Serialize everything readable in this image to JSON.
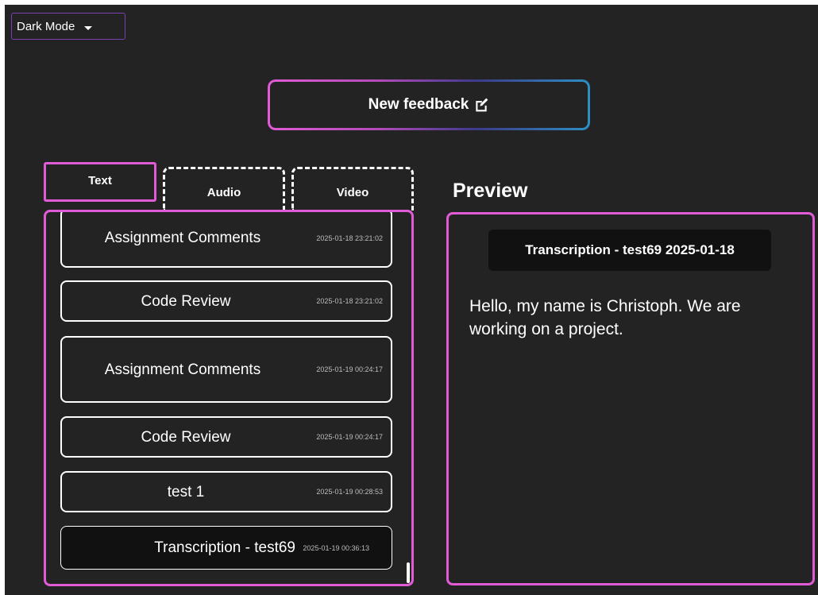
{
  "theme": {
    "selected": "Dark Mode"
  },
  "new_feedback": {
    "label": "New feedback"
  },
  "tabs": [
    {
      "label": "Text",
      "active": true
    },
    {
      "label": "Audio",
      "active": false
    },
    {
      "label": "Video",
      "active": false
    }
  ],
  "feedback_list": [
    {
      "title": "Assignment Comments",
      "date": "2025-01-18 23:21:02"
    },
    {
      "title": "Code Review",
      "date": "2025-01-18 23:21:02"
    },
    {
      "title": "Assignment Comments",
      "date": "2025-01-19 00:24:17"
    },
    {
      "title": "Code Review",
      "date": "2025-01-19 00:24:17"
    },
    {
      "title": "test 1",
      "date": "2025-01-19 00:28:53"
    },
    {
      "title": "Transcription - test69",
      "date": "2025-01-19 00:36:13",
      "selected": true
    }
  ],
  "preview": {
    "heading": "Preview",
    "title": "Transcription - test69 2025-01-18",
    "body": "Hello, my name is Christoph. We are working on a project."
  },
  "colors": {
    "background": "#232323",
    "accent_pink": "#e25bd6",
    "accent_blue": "#2c8fc4",
    "theme_border": "#7a3fb0"
  },
  "icons": {
    "new_feedback": "edit-icon",
    "theme": "caret-down-icon"
  }
}
